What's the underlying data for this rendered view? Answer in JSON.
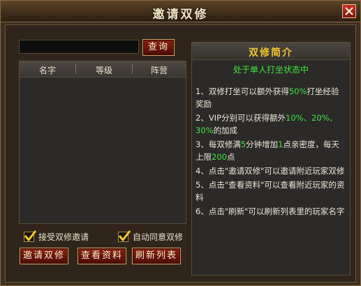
{
  "window": {
    "title": "邀请双修",
    "close_label": "×"
  },
  "search": {
    "placeholder": "",
    "value": "",
    "button_label": "查询"
  },
  "list": {
    "columns": [
      "名字",
      "等级",
      "阵营"
    ],
    "rows": []
  },
  "options": [
    {
      "label": "接受双修邀请",
      "checked": true
    },
    {
      "label": "自动同意双修",
      "checked": true
    }
  ],
  "buttons": {
    "invite": "邀请双修",
    "view": "查看资料",
    "refresh": "刷新列表"
  },
  "intro": {
    "title": "双修简介",
    "subtitle": "处于单人打坐状态中",
    "items": [
      {
        "segments": [
          {
            "t": "1、双修打坐可以额外获得"
          },
          {
            "t": "50%",
            "g": 1
          },
          {
            "t": "打坐经验奖励"
          }
        ]
      },
      {
        "segments": [
          {
            "t": "2、VIP分别可以获得额外"
          },
          {
            "t": "10%、20%、30%",
            "g": 1
          },
          {
            "t": "的加成"
          }
        ]
      },
      {
        "segments": [
          {
            "t": "3、每双修满"
          },
          {
            "t": "5",
            "g": 1
          },
          {
            "t": "分钟增加"
          },
          {
            "t": "1",
            "g": 1
          },
          {
            "t": "点亲密度，每天上限"
          },
          {
            "t": "200",
            "g": 1
          },
          {
            "t": "点"
          }
        ]
      },
      {
        "segments": [
          {
            "t": "4、点击\"邀请双修\"可以邀请附近玩家双修"
          }
        ]
      },
      {
        "segments": [
          {
            "t": "5、点击\"查看资料\"可以查看附近玩家的资料"
          }
        ]
      },
      {
        "segments": [
          {
            "t": "6、点击\"刷新\"可以刷新列表里的玩家名字"
          }
        ]
      }
    ]
  },
  "colors": {
    "highlight": "#3ee63e",
    "title_gold": "#f0c830"
  }
}
